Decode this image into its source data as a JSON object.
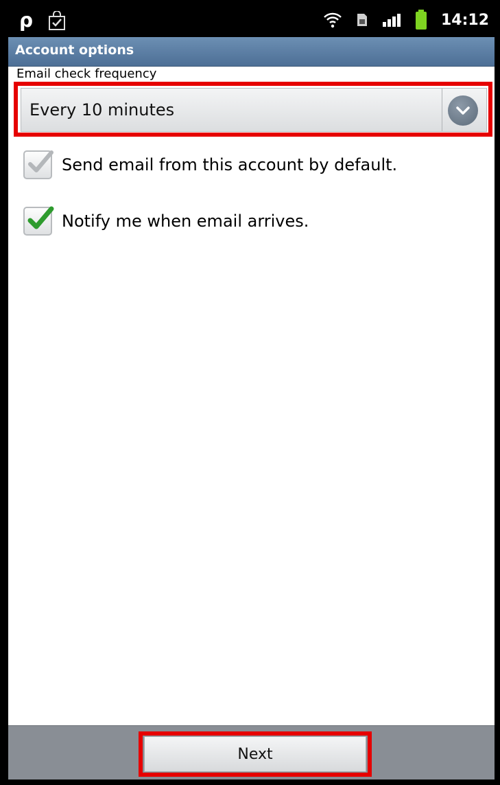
{
  "status_bar": {
    "time": "14:12",
    "left_icons": [
      "p-app-icon",
      "shopping-bag-check-icon"
    ],
    "right_icons": [
      "wifi-icon",
      "sim-card-icon",
      "signal-icon",
      "battery-icon"
    ]
  },
  "title_bar": {
    "title": "Account options"
  },
  "frequency": {
    "label": "Email check frequency",
    "selected": "Every 10 minutes"
  },
  "options": [
    {
      "label": "Send email from this account by default.",
      "checked": false
    },
    {
      "label": "Notify me when email arrives.",
      "checked": true
    }
  ],
  "footer": {
    "next_label": "Next"
  },
  "colors": {
    "title_bar": "#5a7ca2",
    "highlight": "#e60000",
    "check_green": "#2e9b2e",
    "bottom_bar": "#898e95"
  }
}
